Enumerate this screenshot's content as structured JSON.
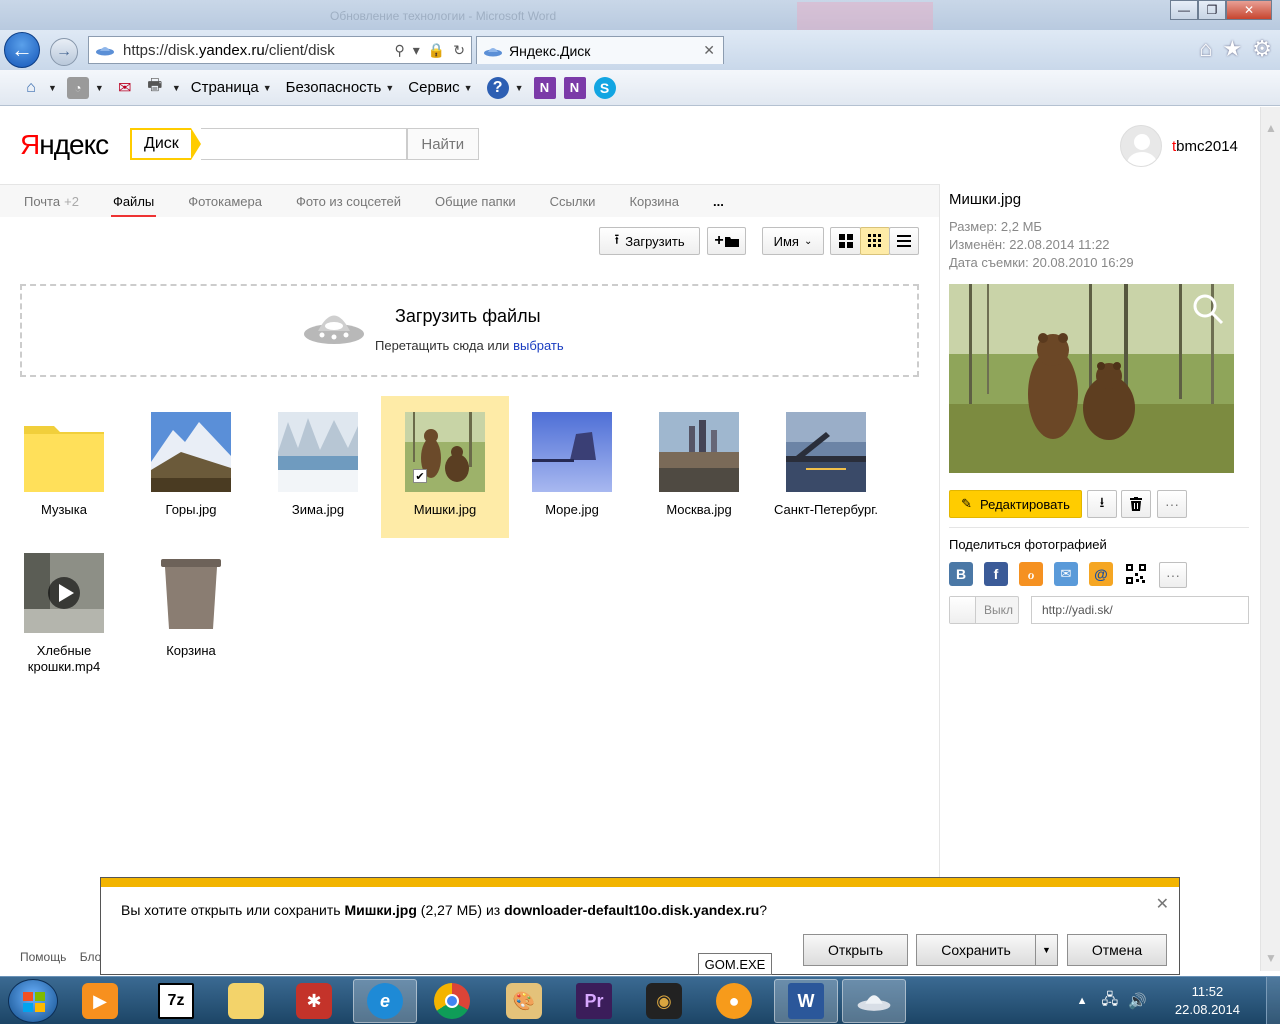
{
  "window": {
    "ghost_title": "Обновление технологии - Microsoft Word",
    "minimize": "—",
    "restore": "❐",
    "close": "✕"
  },
  "browser": {
    "url_prefix": "https://disk.",
    "url_domain": "yandex.ru",
    "url_path": "/client/disk",
    "tab_title": "Яндекс.Диск",
    "tab_close": "✕"
  },
  "command_bar": {
    "page": "Страница",
    "security": "Безопасность",
    "service": "Сервис"
  },
  "header": {
    "logo_first": "Я",
    "logo_rest": "ндекс",
    "search_tag": "Диск",
    "search_button": "Найти",
    "user_first": "t",
    "user_rest": "bmc2014"
  },
  "tabs": [
    {
      "label": "Почта",
      "count": "+2"
    },
    {
      "label": "Файлы"
    },
    {
      "label": "Фотокамера"
    },
    {
      "label": "Фото из соцсетей"
    },
    {
      "label": "Общие папки"
    },
    {
      "label": "Ссылки"
    },
    {
      "label": "Корзина"
    },
    {
      "label": "..."
    }
  ],
  "toolbar": {
    "upload": "Загрузить",
    "new_folder": "+",
    "sort": "Имя"
  },
  "dropzone": {
    "title": "Загрузить файлы",
    "hint": "Перетащить сюда или",
    "hint_link": "выбрать"
  },
  "files": [
    {
      "name": "Музыка",
      "kind": "folder"
    },
    {
      "name": "Горы.jpg",
      "kind": "image"
    },
    {
      "name": "Зима.jpg",
      "kind": "image"
    },
    {
      "name": "Мишки.jpg",
      "kind": "image",
      "selected": true
    },
    {
      "name": "Море.jpg",
      "kind": "image"
    },
    {
      "name": "Москва.jpg",
      "kind": "image"
    },
    {
      "name": "Санкт-Петербург.",
      "kind": "image"
    },
    {
      "name_line1": "Хлебные",
      "name_line2": "крошки.mp4",
      "kind": "video"
    },
    {
      "name": "Корзина",
      "kind": "trash"
    }
  ],
  "side_panel": {
    "file_name": "Мишки.jpg",
    "size": "Размер: 2,2 МБ",
    "modified": "Изменён: 22.08.2014 11:22",
    "taken": "Дата съемки: 20.08.2010 16:29",
    "edit_button": "Редактировать",
    "more": "···",
    "share_label": "Поделиться фотографией",
    "switch_off": "Выкл",
    "link_placeholder": "http://yadi.sk/"
  },
  "footer": {
    "help": "Помощь",
    "blog": "Бло"
  },
  "download_bar": {
    "msg_before": "Вы хотите открыть или сохранить ",
    "file": "Мишки.jpg",
    "msg_size": " (2,27 МБ) из ",
    "host": "downloader-default10o.disk.yandex.ru",
    "msg_after": "?",
    "open": "Открыть",
    "save": "Сохранить",
    "cancel": "Отмена",
    "close": "✕"
  },
  "tooltip": "GOM.EXE",
  "taskbar": {
    "time": "11:52",
    "date": "22.08.2014"
  },
  "colors": {
    "yandex_red": "#ff0000",
    "accent_yellow": "#ffcc00",
    "selection": "#feeba7",
    "link": "#1a3dc1",
    "download_stripe": "#f2b400"
  }
}
